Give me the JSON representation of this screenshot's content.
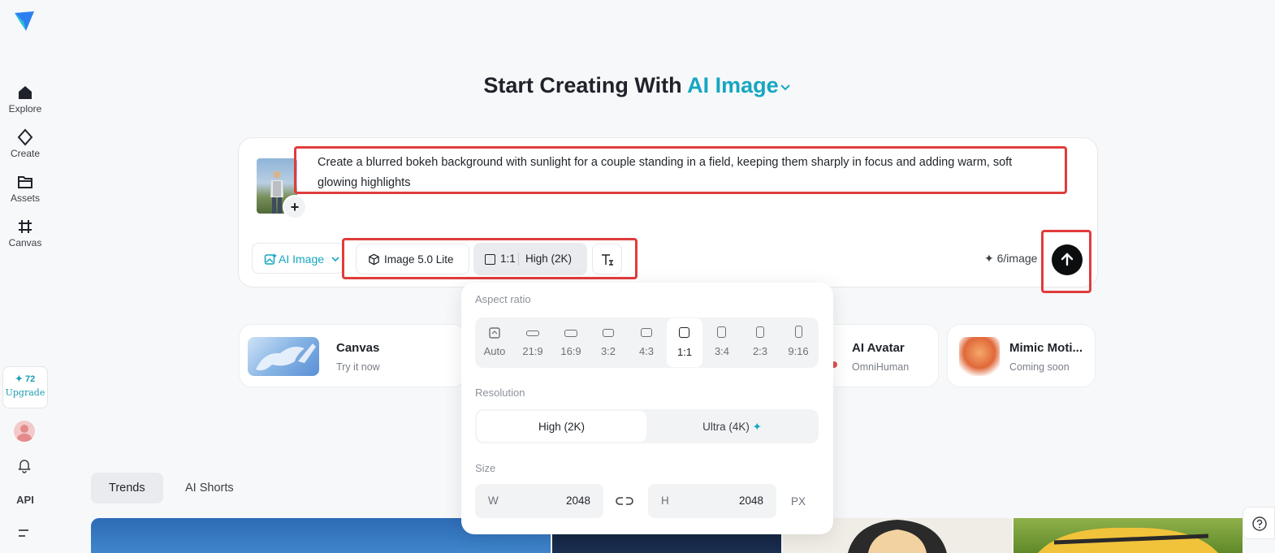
{
  "sidebar": {
    "items": [
      {
        "label": "Explore",
        "icon": "home-icon"
      },
      {
        "label": "Create",
        "icon": "diamond-icon"
      },
      {
        "label": "Assets",
        "icon": "folder-icon"
      },
      {
        "label": "Canvas",
        "icon": "crop-icon"
      }
    ],
    "credits": "✦ 72",
    "upgrade_label": "Upgrade",
    "api_label": "API"
  },
  "header": {
    "title_prefix": "Start Creating With",
    "title_accent": "AI Image"
  },
  "prompt": {
    "text": "Create a blurred bokeh background with sunlight for a couple standing in a field, keeping them sharply in focus and adding warm, soft glowing highlights",
    "add_label": "+"
  },
  "toolbar": {
    "mode_label": "AI Image",
    "model_label": "Image 5.0 Lite",
    "ratio_label": "1:1",
    "quality_label": "High (2K)",
    "cost_label": "✦ 6/image"
  },
  "cards": [
    {
      "title": "Canvas",
      "subtitle": "Try it now"
    },
    {
      "title": "AI Avatar",
      "subtitle": "OmniHuman"
    },
    {
      "title": "Mimic Moti...",
      "subtitle": "Coming soon"
    }
  ],
  "tabs": [
    {
      "label": "Trends",
      "active": true
    },
    {
      "label": "AI Shorts",
      "active": false
    }
  ],
  "panel": {
    "aspect_title": "Aspect ratio",
    "ratios": [
      "Auto",
      "21:9",
      "16:9",
      "3:2",
      "4:3",
      "1:1",
      "3:4",
      "2:3",
      "9:16"
    ],
    "selected_ratio": "1:1",
    "resolution_title": "Resolution",
    "resolutions": [
      "High (2K)",
      "Ultra (4K)"
    ],
    "selected_resolution": "High (2K)",
    "size_title": "Size",
    "width_key": "W",
    "width_value": "2048",
    "height_key": "H",
    "height_value": "2048",
    "unit": "PX"
  },
  "colors": {
    "accent": "#16a6c1",
    "highlight": "#e03c3c"
  }
}
